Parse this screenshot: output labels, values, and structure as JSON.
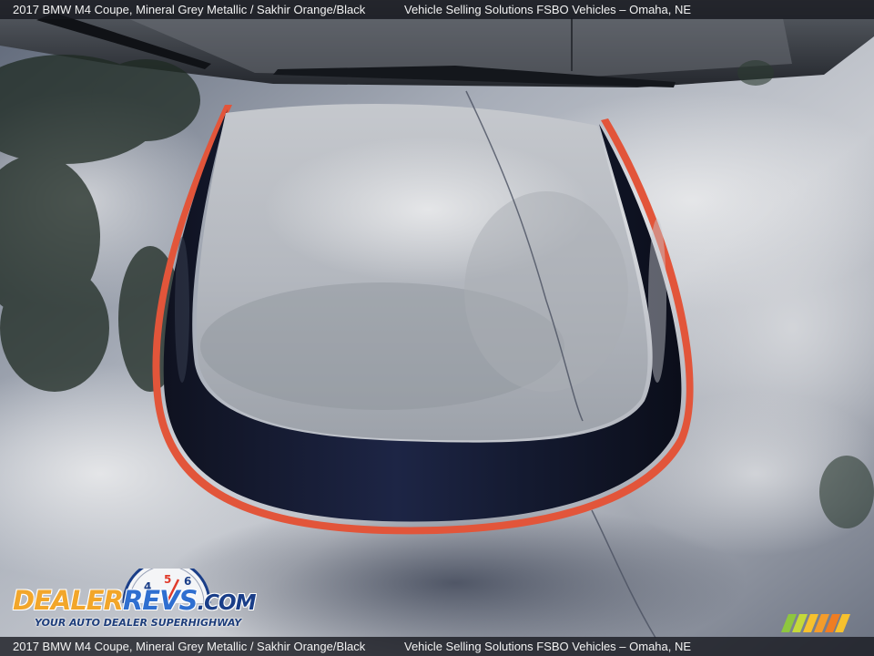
{
  "caption": {
    "left": "2017 BMW M4 Coupe,  Mineral Grey Metallic / Sakhir Orange/Black",
    "right": "Vehicle Selling Solutions FSBO Vehicles – Omaha, NE"
  },
  "logo": {
    "word_dealer": "DEALER",
    "word_revs": "REVS",
    "word_com": ".COM",
    "tagline": "YOUR AUTO DEALER SUPERHIGHWAY",
    "gauge_numerals": [
      "4",
      "5",
      "6"
    ]
  },
  "photo": {
    "subject": "car-hood-with-racing-stripe",
    "colors": {
      "paint": "#2b3142",
      "stripe": "#15192a",
      "pinstripe": "#e2553a",
      "sky": "#c9ccd2"
    }
  },
  "brand_stripes": {
    "colors": [
      "#8ec63f",
      "#c5d93a",
      "#f7c12d",
      "#f39c2b",
      "#ef7d22",
      "#f7c12d"
    ]
  }
}
